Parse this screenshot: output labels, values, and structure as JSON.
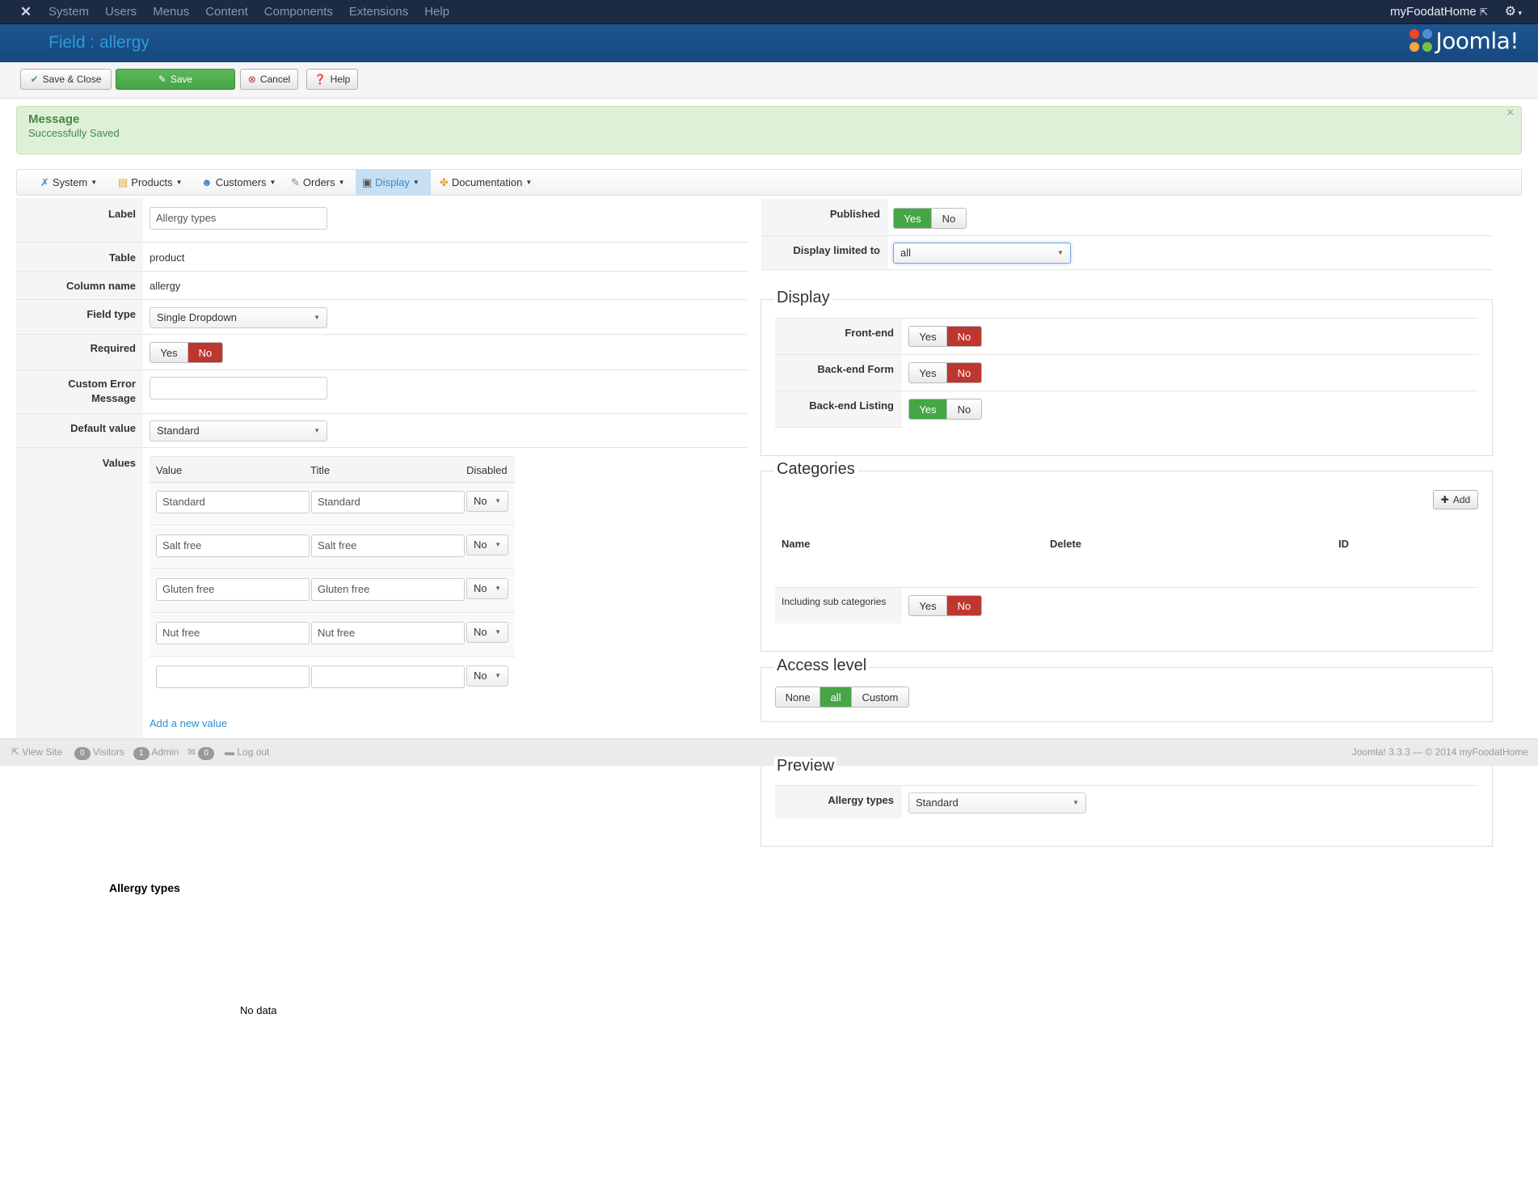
{
  "topbar": {
    "menu": [
      "System",
      "Users",
      "Menus",
      "Content",
      "Components",
      "Extensions",
      "Help"
    ],
    "site_name": "myFoodatHome"
  },
  "header": {
    "title": "Field : allergy",
    "logo_text": "Joomla!"
  },
  "toolbar": {
    "save_close": "Save & Close",
    "save": "Save",
    "cancel": "Cancel",
    "help": "Help"
  },
  "message": {
    "title": "Message",
    "text": "Successfully Saved"
  },
  "subnav": [
    "System",
    "Products",
    "Customers",
    "Orders",
    "Display",
    "Documentation"
  ],
  "form": {
    "label": {
      "label": "Label",
      "value": "Allergy types"
    },
    "table": {
      "label": "Table",
      "value": "product"
    },
    "column": {
      "label": "Column name",
      "value": "allergy"
    },
    "field_type": {
      "label": "Field type",
      "value": "Single Dropdown"
    },
    "required": {
      "label": "Required",
      "yes": "Yes",
      "no": "No",
      "selected": "No"
    },
    "custom_error": {
      "label_1": "Custom Error",
      "label_2": "Message",
      "value": ""
    },
    "default_value": {
      "label": "Default value",
      "value": "Standard"
    },
    "values": {
      "label": "Values",
      "headers": [
        "Value",
        "Title",
        "Disabled"
      ],
      "rows": [
        {
          "value": "Standard",
          "title": "Standard",
          "disabled": "No"
        },
        {
          "value": "Salt free",
          "title": "Salt free",
          "disabled": "No"
        },
        {
          "value": "Gluten free",
          "title": "Gluten free",
          "disabled": "No"
        },
        {
          "value": "Nut free",
          "title": "Nut free",
          "disabled": "No"
        },
        {
          "value": "",
          "title": "",
          "disabled": "No"
        }
      ],
      "add_link": "Add a new value"
    }
  },
  "right": {
    "published": {
      "label": "Published",
      "yes": "Yes",
      "no": "No",
      "selected": "Yes"
    },
    "display_limited": {
      "label": "Display limited to",
      "value": "all"
    },
    "display": {
      "legend": "Display",
      "front_end": {
        "label": "Front-end",
        "selected": "No"
      },
      "back_end_form": {
        "label": "Back-end Form",
        "selected": "No"
      },
      "back_end_listing": {
        "label": "Back-end Listing",
        "selected": "Yes"
      },
      "yes": "Yes",
      "no": "No"
    },
    "categories": {
      "legend": "Categories",
      "add": "Add",
      "headers": [
        "Name",
        "Delete",
        "ID"
      ],
      "including_sub": "Including sub categories",
      "including_selected": "No",
      "yes": "Yes",
      "no": "No"
    },
    "access": {
      "legend": "Access level",
      "options": [
        "None",
        "all",
        "Custom"
      ],
      "selected": "all"
    },
    "preview": {
      "legend": "Preview",
      "label": "Allergy types",
      "value": "Standard"
    }
  },
  "status": {
    "view_site": "View Site",
    "visitors_count": "0",
    "visitors": "Visitors",
    "admin_count": "1",
    "admin": "Admin",
    "msg_count": "0",
    "logout": "Log out",
    "version": "Joomla! 3.3.3 — © 2014 myFoodatHome"
  },
  "below": {
    "label": "Allergy types",
    "no_data": "No data"
  },
  "colors": {
    "green": "#46a546",
    "red": "#bd362f",
    "header_blue": "#1e5591",
    "title_blue": "#2c9ad8"
  }
}
